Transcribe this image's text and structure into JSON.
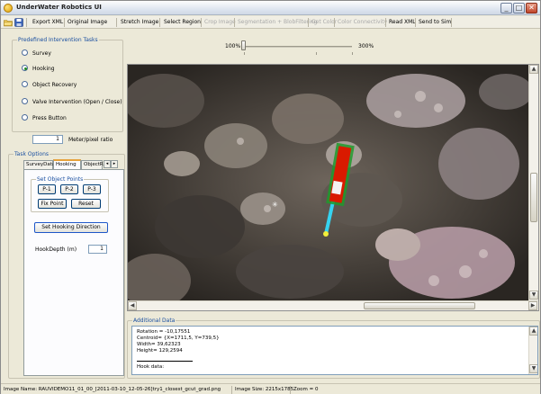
{
  "window": {
    "title": "UnderWater Robotics UI",
    "controls": {
      "minimize": "_",
      "maximize": "□",
      "close": "✕"
    }
  },
  "toolbar": {
    "icons": [
      "folder-open-icon",
      "save-icon"
    ],
    "items": [
      {
        "label": "Export XML",
        "enabled": true
      },
      {
        "label": "Original Image",
        "enabled": true
      },
      {
        "label": "Stretch Image",
        "enabled": true
      },
      {
        "label": "Select Region",
        "enabled": true
      },
      {
        "label": "Crop Image",
        "enabled": false
      },
      {
        "label": "Segmentation + BlobFiltering",
        "enabled": false
      },
      {
        "label": "Get Color",
        "enabled": false
      },
      {
        "label": "Color Connectivity",
        "enabled": false
      },
      {
        "label": "Read XML",
        "enabled": true
      },
      {
        "label": "Send to Sim",
        "enabled": true
      }
    ]
  },
  "tasks": {
    "title": "Predefined Intervention Tasks",
    "options": [
      {
        "label": "Survey",
        "checked": false
      },
      {
        "label": "Hooking",
        "checked": true
      },
      {
        "label": "Object Recovery",
        "checked": false
      },
      {
        "label": "Valve Intervention (Open / Close)",
        "checked": false
      },
      {
        "label": "Press Button",
        "checked": false
      }
    ]
  },
  "ratio": {
    "value": "1",
    "label": "Meter/pixel ratio"
  },
  "task_options": {
    "title": "Task Options",
    "tabs": [
      {
        "label": "SurveyData",
        "active": false
      },
      {
        "label": "Hooking",
        "active": true
      },
      {
        "label": "ObjectR",
        "active": false
      }
    ],
    "tab_scroll": {
      "left": "◂",
      "right": "▸"
    },
    "set_object_points": {
      "title": "Set Object Points",
      "buttons": [
        "P-1",
        "P-2",
        "P-3",
        "Fix Point",
        "Reset"
      ]
    },
    "set_hooking_direction": "Set Hooking Direction",
    "hook_depth": {
      "label": "HookDepth (m)",
      "value": "1"
    }
  },
  "zoom": {
    "min_label": "100%",
    "max_label": "300%",
    "value_percent": 100
  },
  "image_view": {
    "scroll": {
      "up": "▲",
      "down": "▼",
      "left": "◀",
      "right": "▶"
    },
    "annotation_colors": {
      "roi": "#1e9a2a",
      "object": "#d91a00",
      "hook_vector": "#35d3f0",
      "hook_point": "#f2ee3a"
    }
  },
  "additional_data": {
    "title": "Additional Data",
    "lines": [
      "Rotation = -10,17551",
      "Centroid= {X=1711,5, Y=739,5}",
      "Width= 39,62323",
      "Height= 129,2594",
      "",
      "Hook data:"
    ]
  },
  "status": {
    "image_name": "Image Name: RAUVIDEMO11_01_00_[2011-03-10_12-05-26]try1_closest_gcut_grad.png",
    "image_size": "Image Size: 2215x1785",
    "zoom": "Zoom = 0"
  }
}
